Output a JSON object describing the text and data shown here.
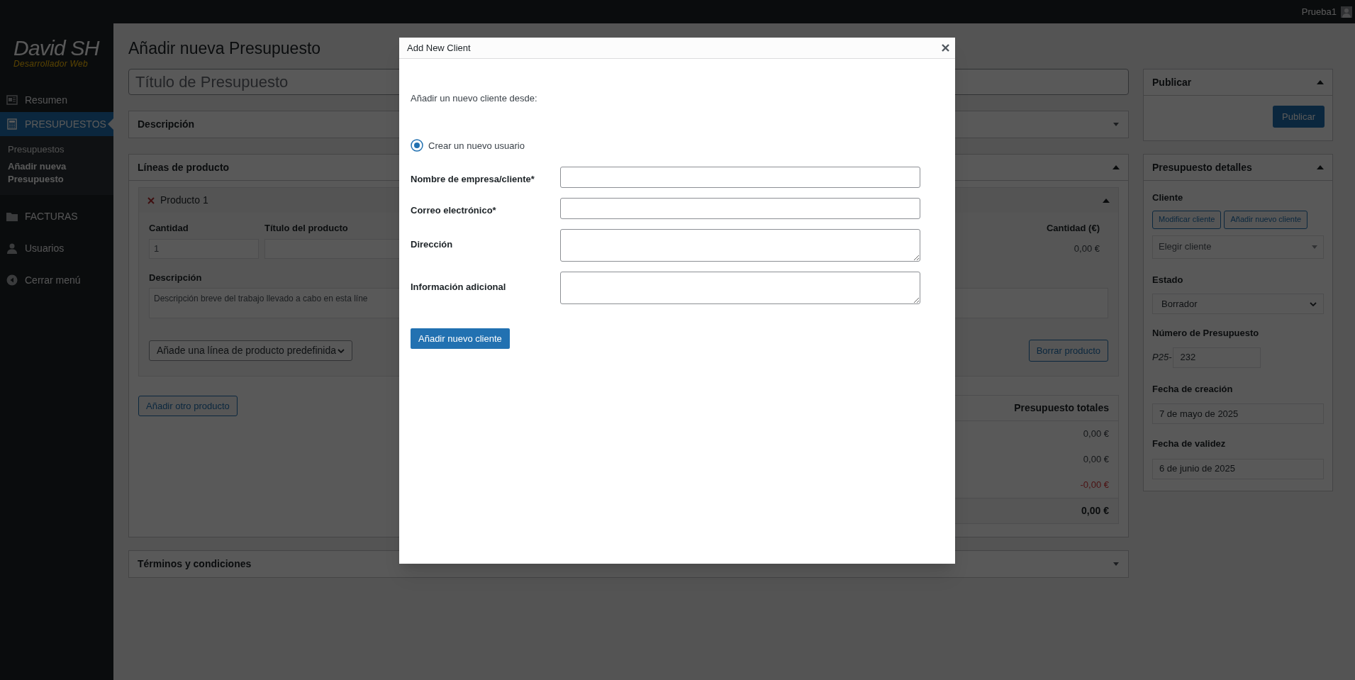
{
  "top_bar": {
    "user": "Prueba1"
  },
  "sidebar": {
    "logo": {
      "title": "David SH",
      "subtitle": "Desarrollador Web"
    },
    "items": [
      {
        "label": "Resumen",
        "selected": false
      },
      {
        "label": "PRESUPUESTOS",
        "selected": true,
        "children": [
          {
            "label": "Presupuestos",
            "selected": false
          },
          {
            "label": "Añadir nueva Presupuesto",
            "selected": true
          }
        ]
      },
      {
        "label": "FACTURAS",
        "selected": false
      },
      {
        "label": "Usuarios",
        "selected": false
      },
      {
        "label": "Cerrar menú",
        "selected": false
      }
    ]
  },
  "page_title": "Añadir nueva Presupuesto",
  "title_field": {
    "placeholder": "Título de Presupuesto"
  },
  "description_box": {
    "title": "Descripción",
    "expanded": false
  },
  "product_lines": {
    "title": "Líneas de producto",
    "expanded": true,
    "product": {
      "title": "Producto 1",
      "expanded": true,
      "quantity_label": "Cantidad",
      "quantity_placeholder": "1",
      "product_title_label": "Título del producto",
      "amount_label": "Cantidad (€)",
      "amount": "0,00 €",
      "description_label": "Descripción",
      "description_placeholder": "Descripción breve del trabajo llevado a cabo en esta líne",
      "predefined_select": "Añade una línea de producto predefinida",
      "delete_button": "Borrar producto"
    },
    "add_button": "Añadir otro producto",
    "totals": {
      "title": "Presupuesto totales",
      "rows": [
        {
          "value": "0,00 €",
          "kind": "normal"
        },
        {
          "value": "0,00 €",
          "kind": "normal"
        },
        {
          "value": "-0,00 €",
          "kind": "discount"
        },
        {
          "value": "0,00 €",
          "kind": "total"
        }
      ]
    }
  },
  "terms_box": {
    "title": "Términos y condiciones",
    "expanded": false
  },
  "publish_box": {
    "title": "Publicar",
    "expanded": true,
    "button": "Publicar"
  },
  "details_box": {
    "title": "Presupuesto detalles",
    "expanded": true,
    "client_label": "Cliente",
    "client_buttons": [
      "Modificar cliente",
      "Añadir nuevo cliente"
    ],
    "client_select": {
      "placeholder": "Elegir cliente"
    },
    "status_label": "Estado",
    "status_value": "Borrador",
    "number_label": "Número de Presupuesto",
    "number_prefix": "P25-",
    "number_value": "232",
    "created_label": "Fecha de creación",
    "created_value": "7 de mayo de 2025",
    "valid_label": "Fecha de validez",
    "valid_value": "6 de junio de 2025"
  },
  "modal": {
    "title": "Add New Client",
    "intro": "Añadir un nuevo cliente desde:",
    "options": [
      {
        "label": "Crear un nuevo usuario",
        "selected": true
      }
    ],
    "fields": [
      {
        "label": "Nombre de empresa/cliente*",
        "kind": "input"
      },
      {
        "label": "Correo electrónico*",
        "kind": "input"
      },
      {
        "label": "Dirección",
        "kind": "textarea"
      },
      {
        "label": "Información adicional",
        "kind": "textarea"
      }
    ],
    "submit": "Añadir nuevo cliente"
  }
}
